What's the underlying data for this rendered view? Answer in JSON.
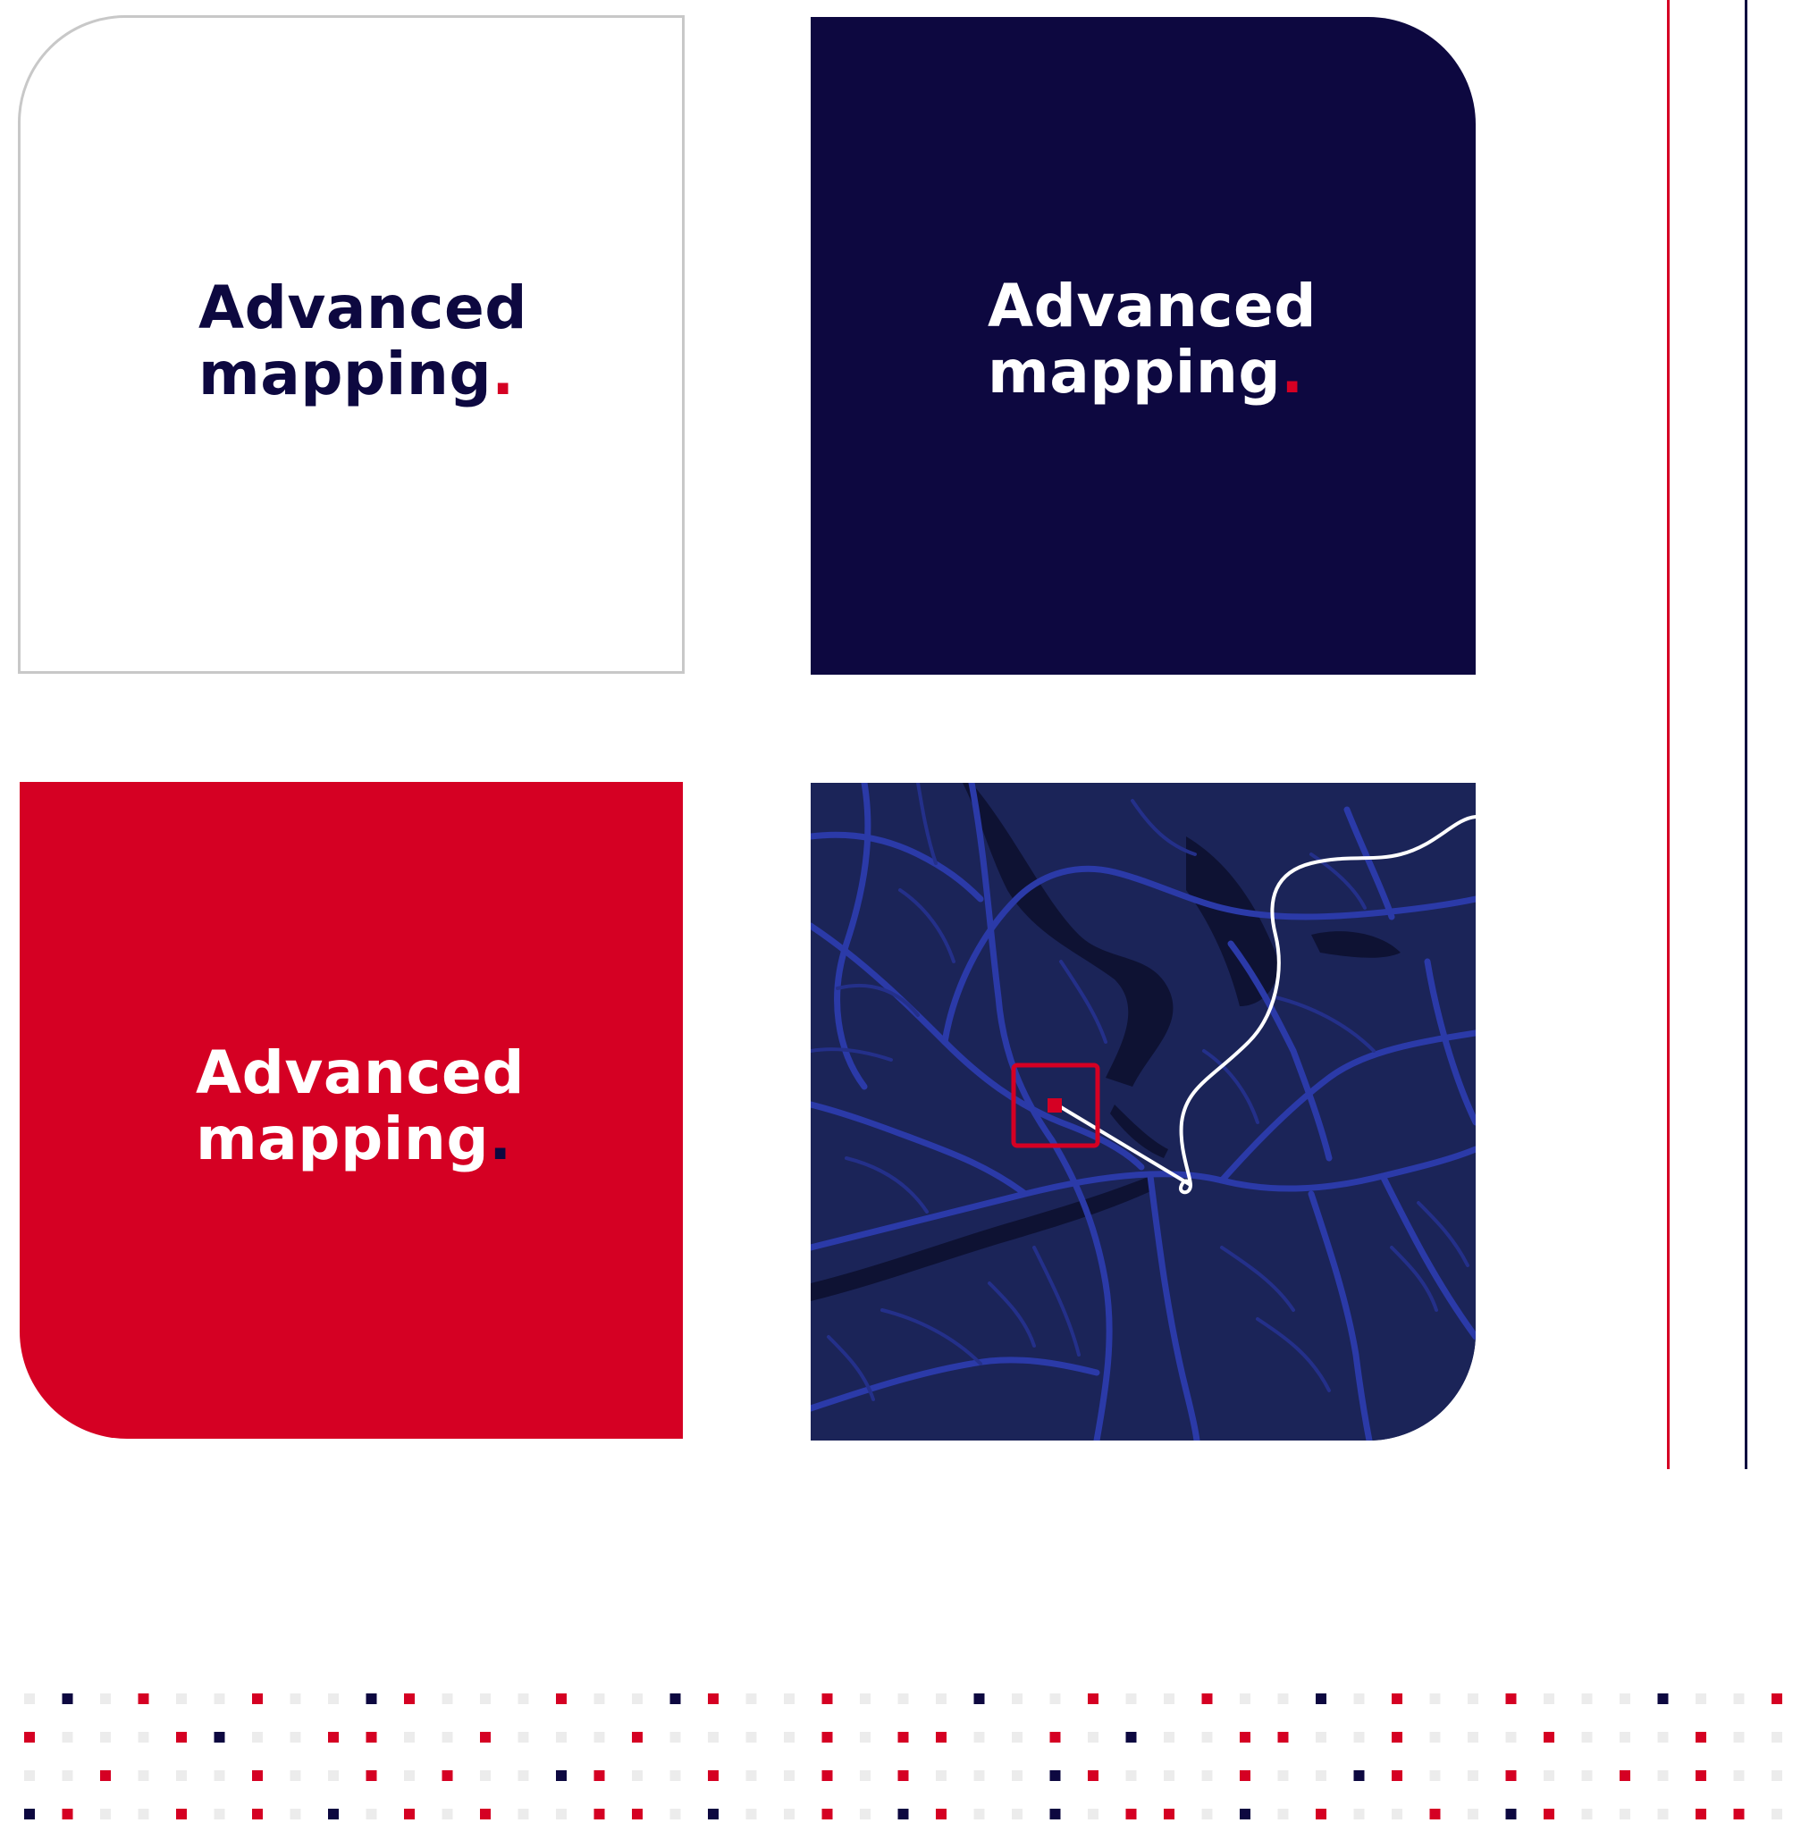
{
  "colors": {
    "navy": "#0d0840",
    "red": "#d50023",
    "map_bg": "#1b2458",
    "map_road": "#2b3aa8",
    "map_road_dim": "#24308a",
    "map_dark": "#0e1233",
    "white": "#ffffff",
    "dot_gray": "#ececec",
    "card_border": "#c8c8c8"
  },
  "cards": {
    "white": {
      "line1": "Advanced",
      "line2": "mapping",
      "period": "."
    },
    "navy": {
      "line1": "Advanced",
      "line2": "mapping",
      "period": "."
    },
    "red": {
      "line1": "Advanced",
      "line2": "mapping",
      "period": "."
    }
  },
  "map": {
    "icons": [
      "route-line-icon",
      "location-marker-icon"
    ]
  },
  "dot_pattern": {
    "rows": [
      "gngrggrggnrgggrggnrggrgggnggrggrggngrggrgggnggrggrggnrggrgggnggr",
      "rgggrnggrrggrgggrggggrgrrggrgnggrrggrgggrgggrggrnggrrgggrgrrggnr",
      "ggrgggrggrgrggnrggrggrgrgggnrgggrggnrggrggrgrggngrggrgrggrgngrgg",
      "nrggrgrgngrgrggrrgnggrgnrggngrrgngrggrgnrgggrrggnggrgrngrgggnrgg"
    ]
  }
}
